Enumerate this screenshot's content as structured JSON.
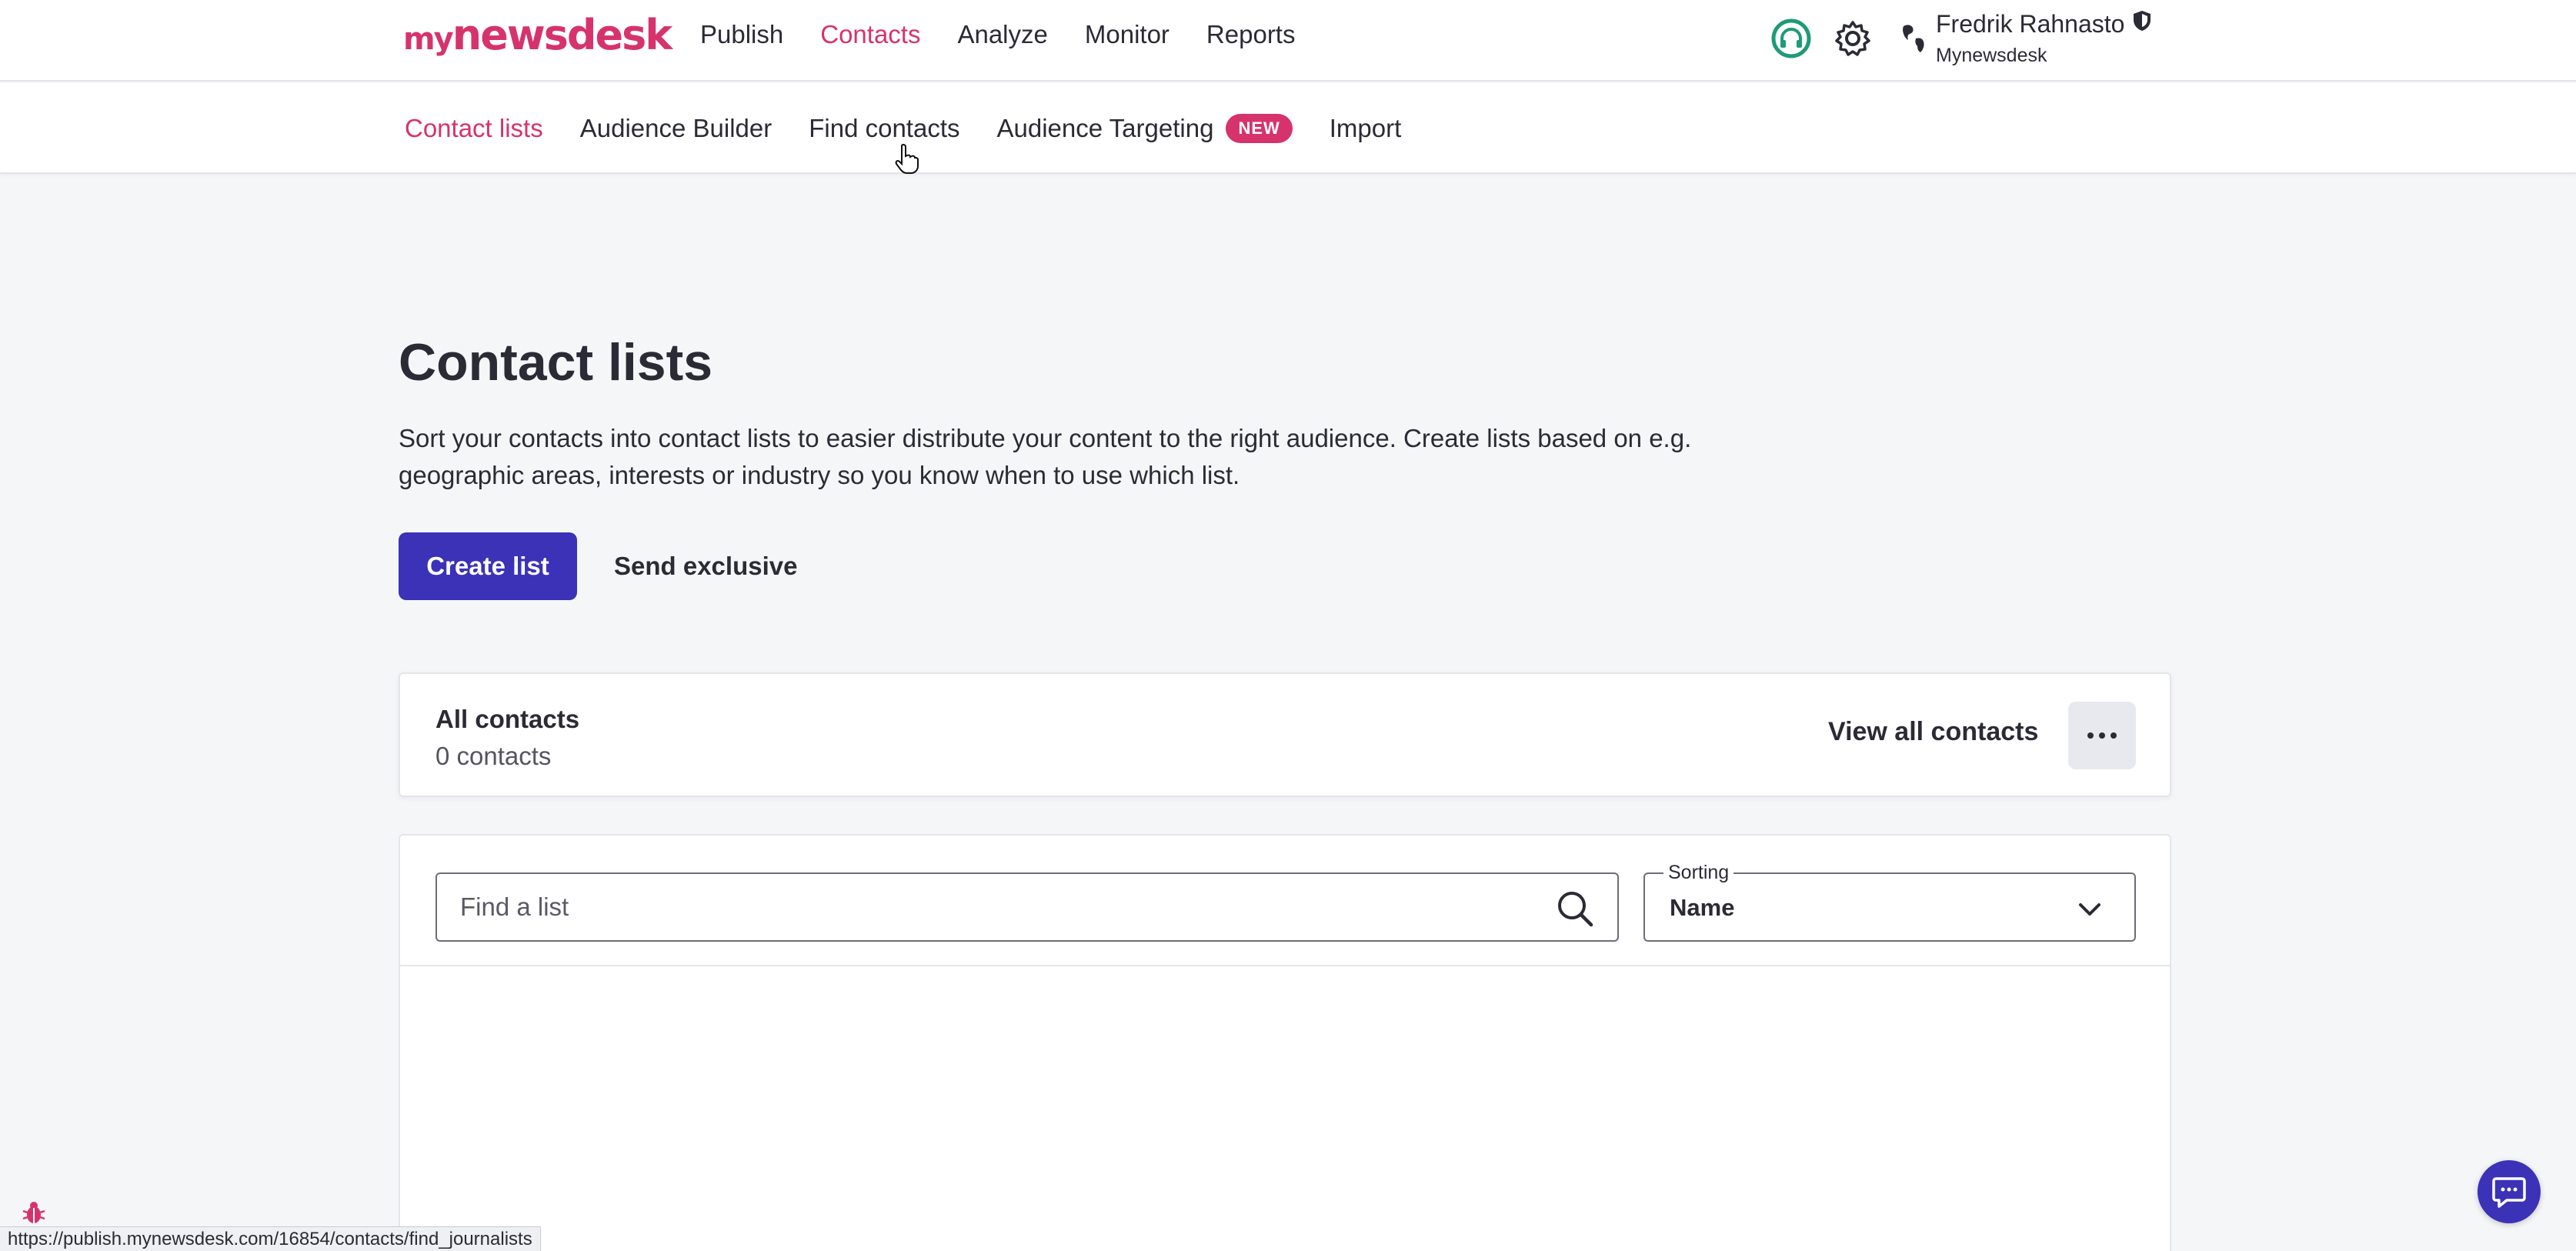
{
  "brand": {
    "logo_my": "my",
    "logo_rest": "newsdesk",
    "accent": "#d6336c",
    "primary": "#3b32b8"
  },
  "main_nav": {
    "items": [
      {
        "label": "Publish"
      },
      {
        "label": "Contacts",
        "active": true
      },
      {
        "label": "Analyze"
      },
      {
        "label": "Monitor"
      },
      {
        "label": "Reports"
      }
    ]
  },
  "top_icons": [
    "headset-icon",
    "gear-icon",
    "world-icon"
  ],
  "user": {
    "name": "Fredrik Rahnasto",
    "org": "Mynewsdesk",
    "badge_icon": "shield-icon"
  },
  "sub_nav": {
    "items": [
      {
        "label": "Contact lists",
        "active": true
      },
      {
        "label": "Audience Builder"
      },
      {
        "label": "Find contacts"
      },
      {
        "label": "Audience Targeting",
        "badge": "NEW"
      },
      {
        "label": "Import"
      }
    ]
  },
  "page": {
    "title": "Contact lists",
    "description": "Sort your contacts into contact lists to easier distribute your content to the right audience. Create lists based on e.g. geographic areas, interests or industry so you know when to use which list.",
    "create_button": "Create list",
    "exclusive_button": "Send exclusive"
  },
  "all_contacts": {
    "title": "All contacts",
    "count": "0 contacts",
    "view_label": "View all contacts"
  },
  "list_toolbar": {
    "search_placeholder": "Find a list",
    "sorting_label": "Sorting",
    "sorting_value": "Name"
  },
  "status_bar": {
    "url": "https://publish.mynewsdesk.com/16854/contacts/find_journalists"
  }
}
